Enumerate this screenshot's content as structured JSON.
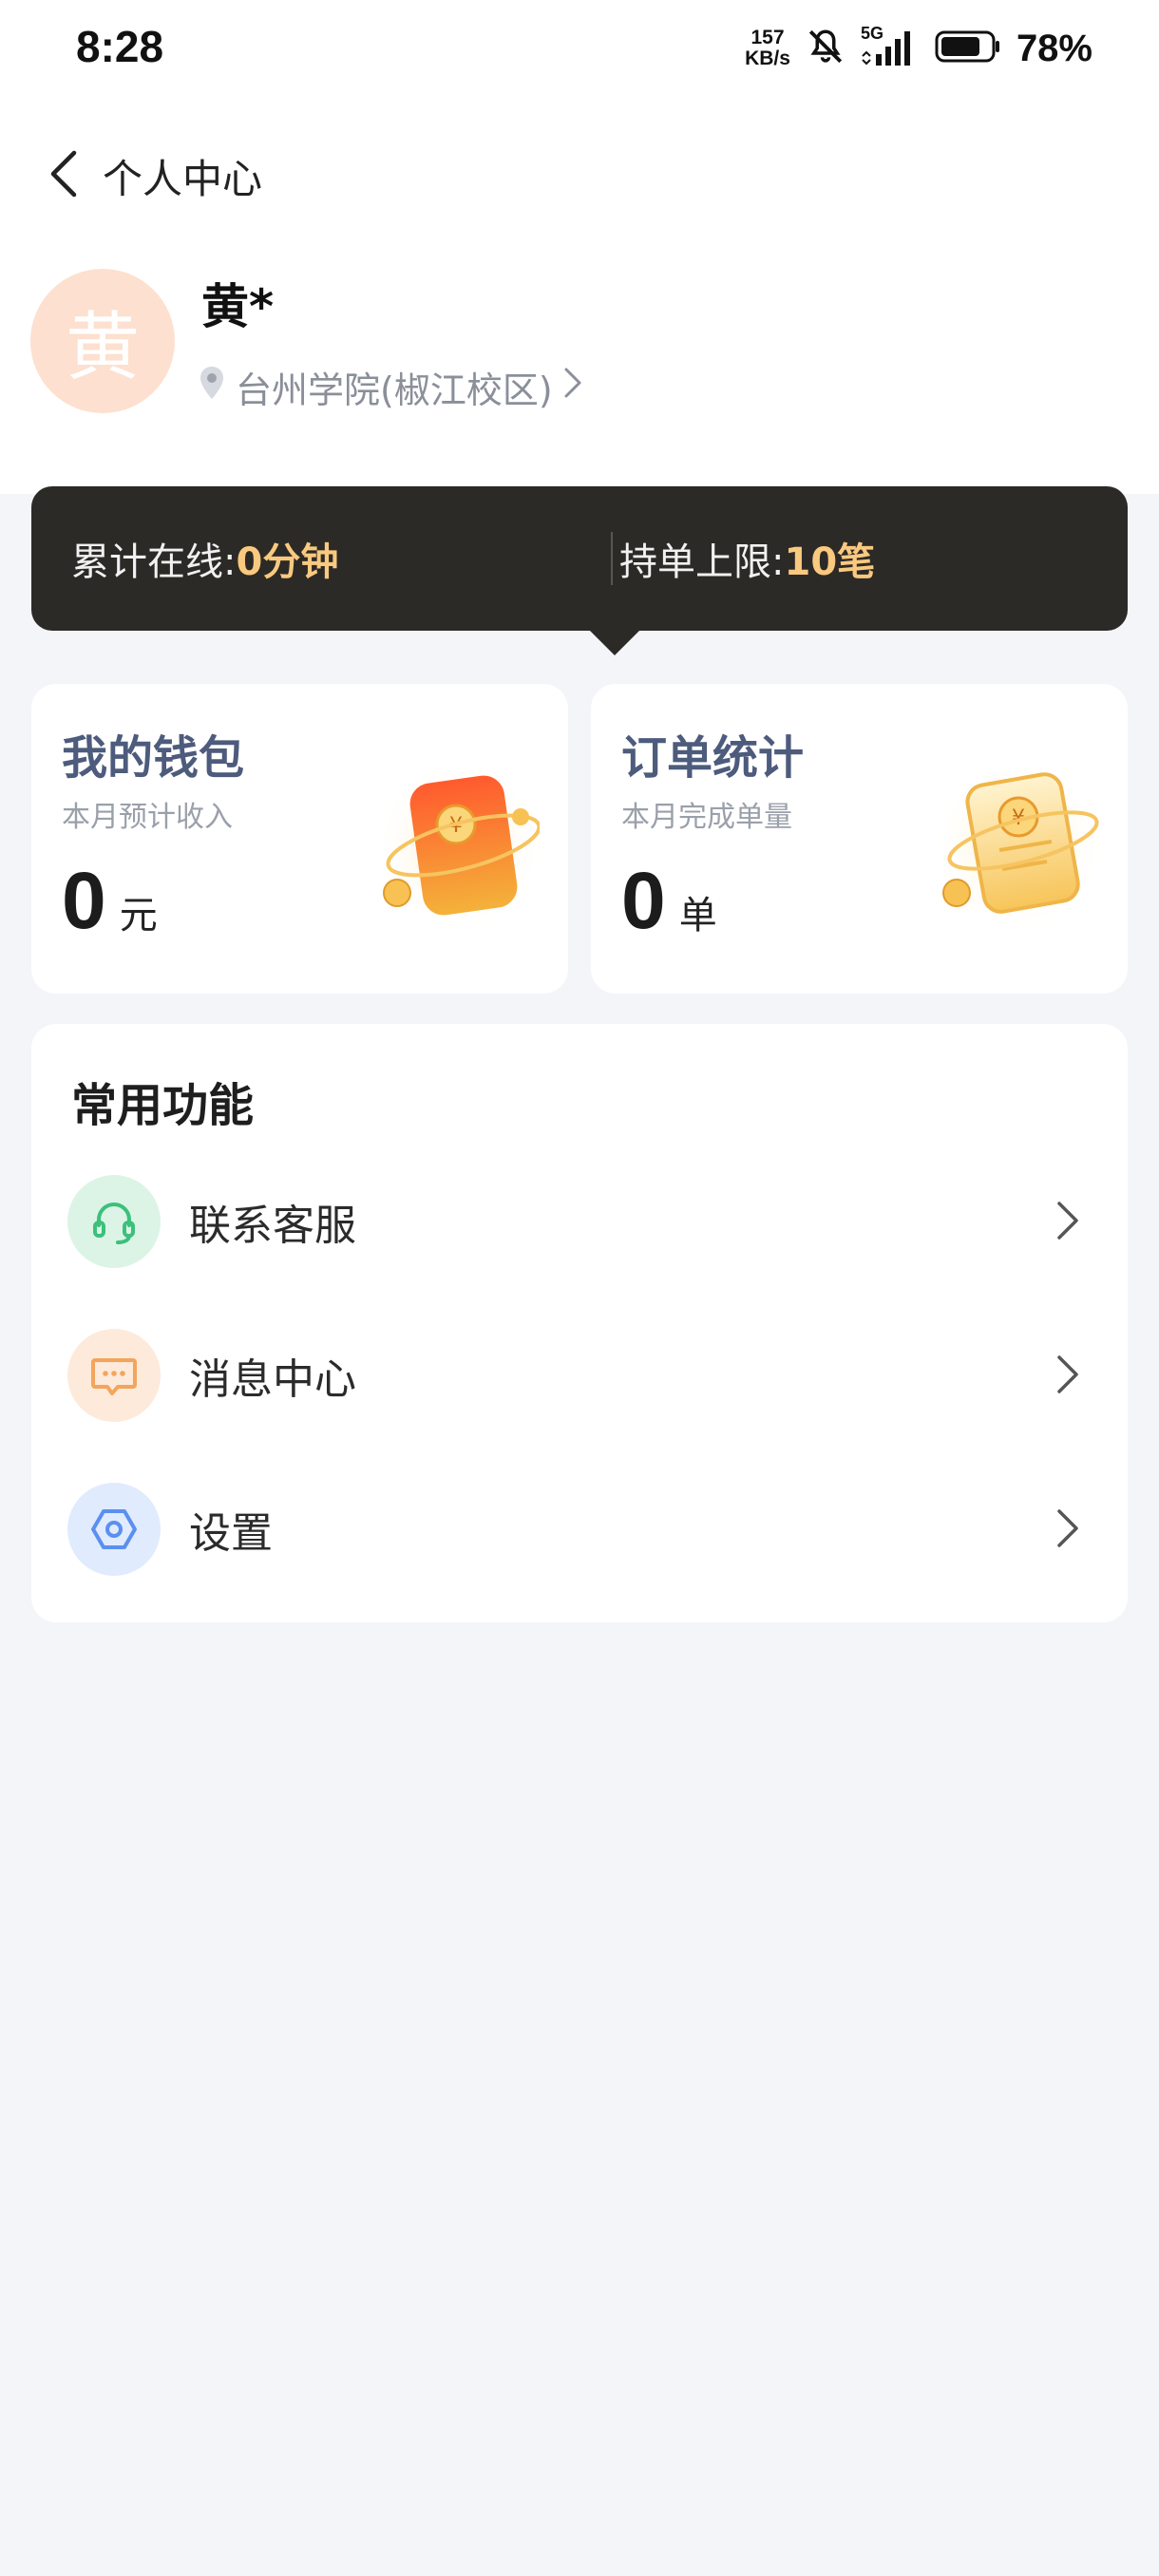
{
  "status_bar": {
    "time": "8:28",
    "net_speed_value": "157",
    "net_speed_unit": "KB/s",
    "network_type": "5G",
    "battery": "78%"
  },
  "header": {
    "title": "个人中心"
  },
  "profile": {
    "avatar_char": "黄",
    "name": "黄*",
    "campus": "台州学院(椒江校区)"
  },
  "stats": {
    "online_label": "累计在线:",
    "online_value": "0分钟",
    "limit_label": "持单上限:",
    "limit_value": "10笔"
  },
  "wallet": {
    "title": "我的钱包",
    "subtitle": "本月预计收入",
    "value": "0",
    "unit": "元"
  },
  "orders": {
    "title": "订单统计",
    "subtitle": "本月完成单量",
    "value": "0",
    "unit": "单"
  },
  "functions": {
    "title": "常用功能",
    "items": [
      {
        "label": "联系客服",
        "icon": "headset-icon",
        "color": "#3cc07b",
        "bg": "#dcf4e6"
      },
      {
        "label": "消息中心",
        "icon": "message-icon",
        "color": "#f2a55c",
        "bg": "#fdeadb"
      },
      {
        "label": "设置",
        "icon": "settings-icon",
        "color": "#5b8ff0",
        "bg": "#e0ebfd"
      }
    ]
  }
}
